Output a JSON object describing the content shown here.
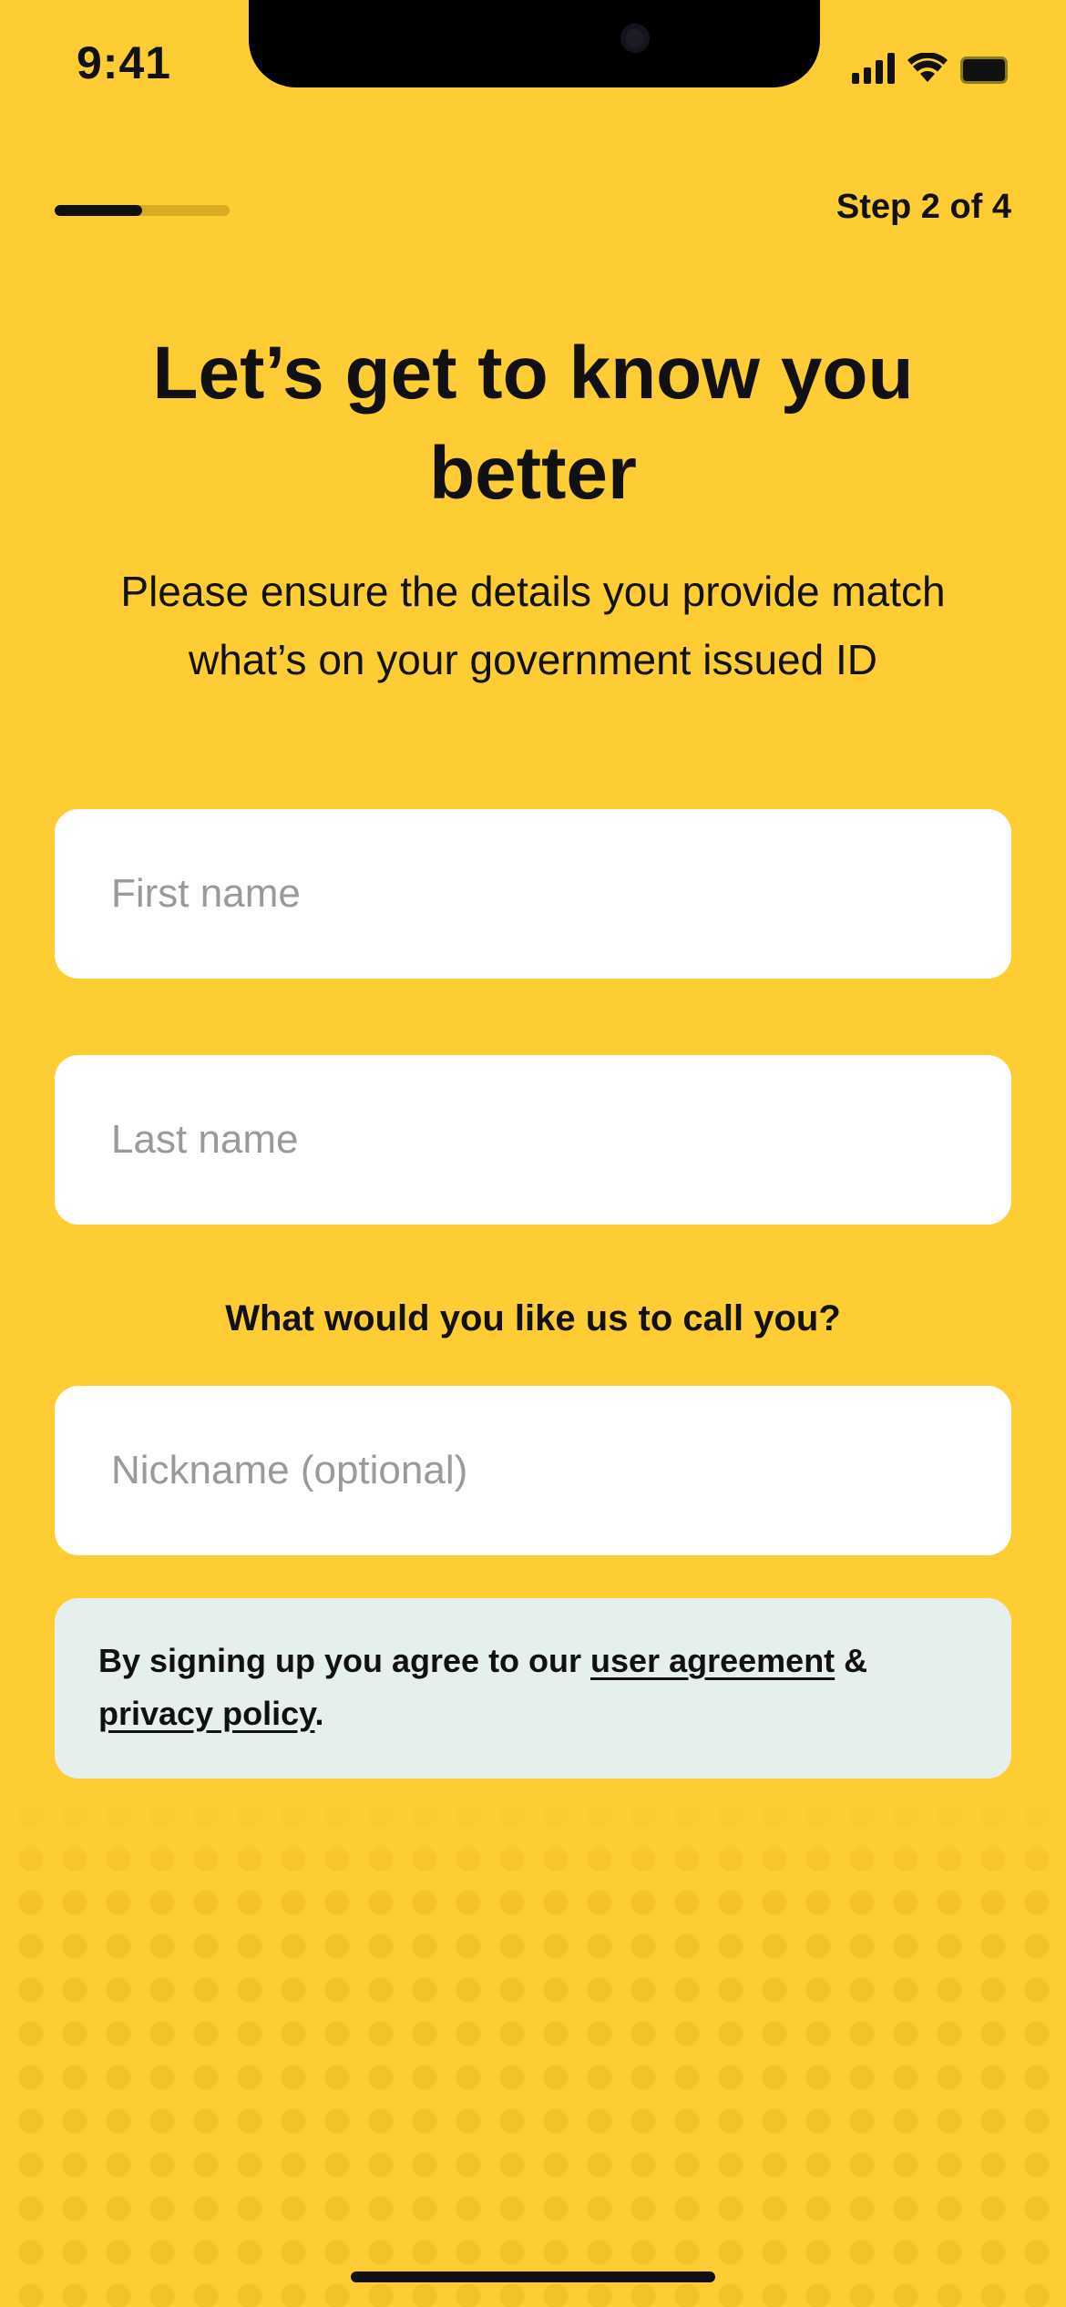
{
  "status_bar": {
    "time": "9:41",
    "icons": [
      "signal-icon",
      "wifi-icon",
      "battery-icon"
    ]
  },
  "progress": {
    "step_label": "Step 2 of 4",
    "fraction": 0.5
  },
  "header": {
    "title": "Let’s get to know you better",
    "subtitle": "Please ensure the details you provide match what’s on your government issued ID"
  },
  "form": {
    "first_name": {
      "placeholder": "First name",
      "value": ""
    },
    "last_name": {
      "placeholder": "Last name",
      "value": ""
    },
    "nickname_question": "What would you like us to call you?",
    "nickname": {
      "placeholder": "Nickname (optional)",
      "value": ""
    }
  },
  "agreement": {
    "prefix": "By signing up you agree to our ",
    "user_agreement_link": "user agreement",
    "separator": " & ",
    "privacy_policy_link": "privacy policy",
    "suffix": "."
  },
  "colors": {
    "background": "#FECD33",
    "text": "#111111",
    "field_background": "#FFFFFF",
    "notice_background": "#E5EFEB",
    "progress_track": "#D9AB22"
  }
}
